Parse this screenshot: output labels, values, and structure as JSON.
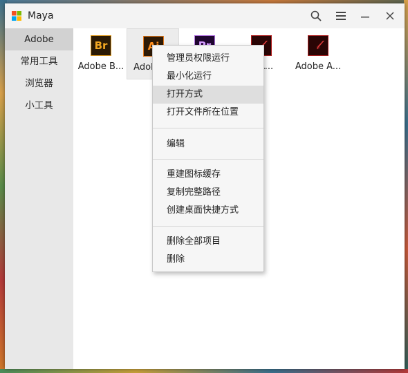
{
  "window": {
    "title": "Maya"
  },
  "icons": {
    "app": "windows-logo-icon",
    "search": "search-icon",
    "menu": "hamburger-menu-icon",
    "minimize": "minimize-icon",
    "close": "close-icon"
  },
  "sidebar": {
    "items": [
      {
        "label": "Adobe",
        "active": true
      },
      {
        "label": "常用工具"
      },
      {
        "label": "浏览器"
      },
      {
        "label": "小工具"
      }
    ]
  },
  "tiles": [
    {
      "icon_text": "Br",
      "label": "Adobe B..."
    },
    {
      "icon_text": "Ai",
      "label": "Adobe ..."
    },
    {
      "icon_text": "Pr",
      "label": ""
    },
    {
      "icon_text": "",
      "label": "e A..."
    },
    {
      "icon_text": "",
      "label": "Adobe A..."
    }
  ],
  "context_menu": {
    "groups": [
      [
        "管理员权限运行",
        "最小化运行",
        "打开方式",
        "打开文件所在位置"
      ],
      [
        "编辑"
      ],
      [
        "重建图标缓存",
        "复制完整路径",
        "创建桌面快捷方式"
      ],
      [
        "删除全部项目",
        "删除"
      ]
    ],
    "highlighted": "打开方式"
  },
  "colors": {
    "sidebar_bg": "#e8e8e8",
    "sidebar_active": "#d2d2d2",
    "titlebar_bg": "#f3f3f3",
    "menu_bg": "#f6f6f6",
    "menu_hover": "#dedede"
  }
}
